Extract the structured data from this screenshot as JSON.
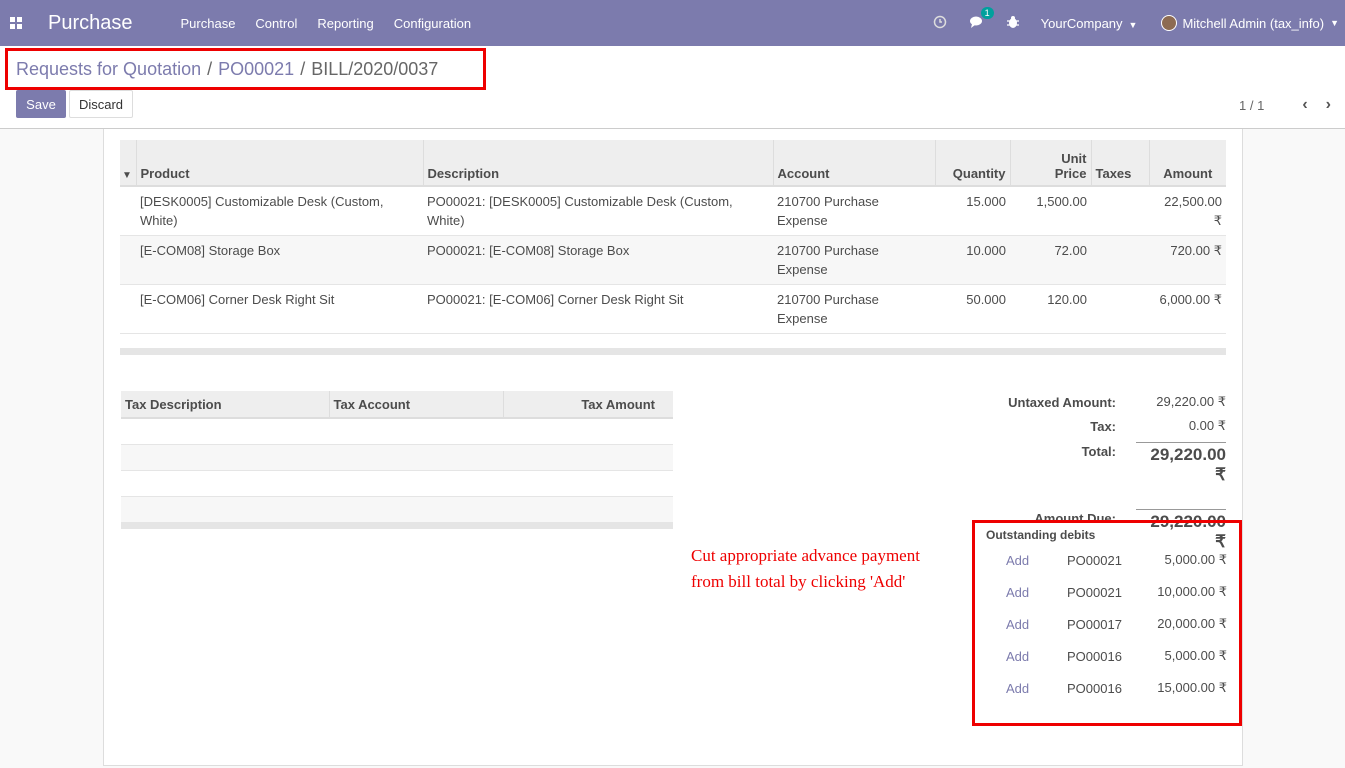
{
  "navbar": {
    "app_title": "Purchase",
    "menu": [
      "Purchase",
      "Control",
      "Reporting",
      "Configuration"
    ],
    "chat_badge": "1",
    "company": "YourCompany",
    "user": "Mitchell Admin (tax_info)"
  },
  "breadcrumb": {
    "root": "Requests for Quotation",
    "parent": "PO00021",
    "current": "BILL/2020/0037",
    "sep": "/"
  },
  "buttons": {
    "save": "Save",
    "discard": "Discard"
  },
  "pager": {
    "value": "1 / 1"
  },
  "lines": {
    "headers": [
      "Product",
      "Description",
      "Account",
      "Quantity",
      "Unit Price",
      "Taxes",
      "Amount"
    ],
    "rows": [
      {
        "product": "[DESK0005] Customizable Desk (Custom, White)",
        "description": "PO00021: [DESK0005] Customizable Desk (Custom, White)",
        "account": "210700 Purchase Expense",
        "quantity": "15.000",
        "unit_price": "1,500.00",
        "taxes": "",
        "amount": "22,500.00 ₹"
      },
      {
        "product": "[E-COM08] Storage Box",
        "description": "PO00021: [E-COM08] Storage Box",
        "account": "210700 Purchase Expense",
        "quantity": "10.000",
        "unit_price": "72.00",
        "taxes": "",
        "amount": "720.00 ₹"
      },
      {
        "product": "[E-COM06] Corner Desk Right Sit",
        "description": "PO00021: [E-COM06] Corner Desk Right Sit",
        "account": "210700 Purchase Expense",
        "quantity": "50.000",
        "unit_price": "120.00",
        "taxes": "",
        "amount": "6,000.00 ₹"
      }
    ]
  },
  "tax_table": {
    "headers": [
      "Tax Description",
      "Tax Account",
      "Tax Amount"
    ]
  },
  "totals": {
    "untaxed_label": "Untaxed Amount:",
    "untaxed_value": "29,220.00 ₹",
    "tax_label": "Tax:",
    "tax_value": "0.00 ₹",
    "total_label": "Total:",
    "total_value": "29,220.00 ₹",
    "due_label": "Amount Due:",
    "due_value": "29,220.00 ₹"
  },
  "annotation": "Cut appropriate advance payment from bill total by clicking 'Add'",
  "outstanding": {
    "title": "Outstanding debits",
    "rows": [
      {
        "action": "Add",
        "ref": "PO00021",
        "amount": "5,000.00 ₹"
      },
      {
        "action": "Add",
        "ref": "PO00021",
        "amount": "10,000.00 ₹"
      },
      {
        "action": "Add",
        "ref": "PO00017",
        "amount": "20,000.00 ₹"
      },
      {
        "action": "Add",
        "ref": "PO00016",
        "amount": "5,000.00 ₹"
      },
      {
        "action": "Add",
        "ref": "PO00016",
        "amount": "15,000.00 ₹"
      }
    ]
  },
  "colors": {
    "brand": "#7c7bad",
    "highlight": "#ee0000",
    "teal_badge": "#00a09d"
  },
  "icons": [
    "apps-icon",
    "clock-icon",
    "chat-icon",
    "bug-icon",
    "chevron-left-icon",
    "chevron-right-icon"
  ]
}
